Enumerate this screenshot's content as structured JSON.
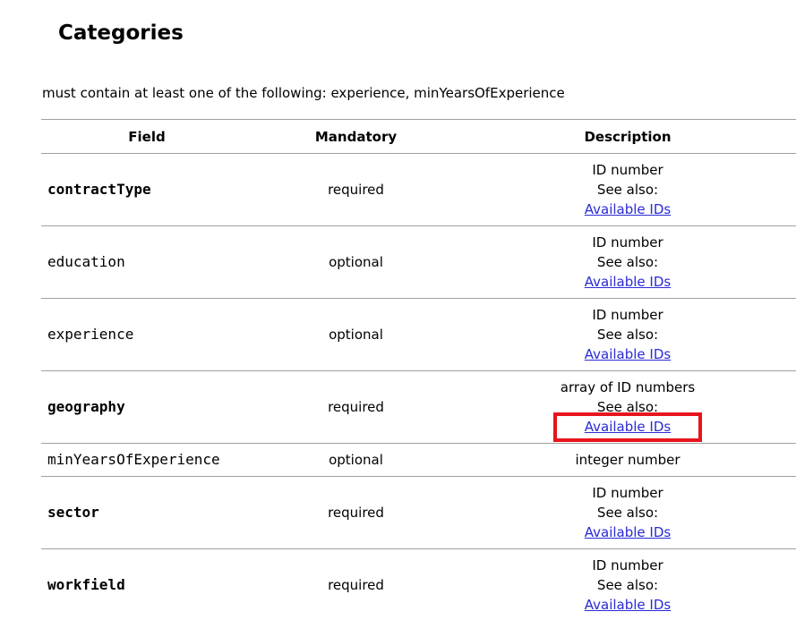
{
  "heading": "Categories",
  "note": "must contain at least one of the following: experience, minYearsOfExperience",
  "table": {
    "headers": [
      "Field",
      "Mandatory",
      "Description"
    ],
    "see_also": "See also:",
    "link_text": "Available IDs",
    "rows": [
      {
        "field": "contractType",
        "mandatory": "required",
        "type": "ID number"
      },
      {
        "field": "education",
        "mandatory": "optional",
        "type": "ID number"
      },
      {
        "field": "experience",
        "mandatory": "optional",
        "type": "ID number"
      },
      {
        "field": "geography",
        "mandatory": "required",
        "type": "array of ID numbers"
      },
      {
        "field": "minYearsOfExperience",
        "mandatory": "optional",
        "type": "integer number"
      },
      {
        "field": "sector",
        "mandatory": "required",
        "type": "ID number"
      },
      {
        "field": "workfield",
        "mandatory": "required",
        "type": "ID number"
      }
    ]
  },
  "colors": {
    "link": "#2a2ad6",
    "highlight": "#e8141c",
    "border": "#a0a0a0"
  }
}
